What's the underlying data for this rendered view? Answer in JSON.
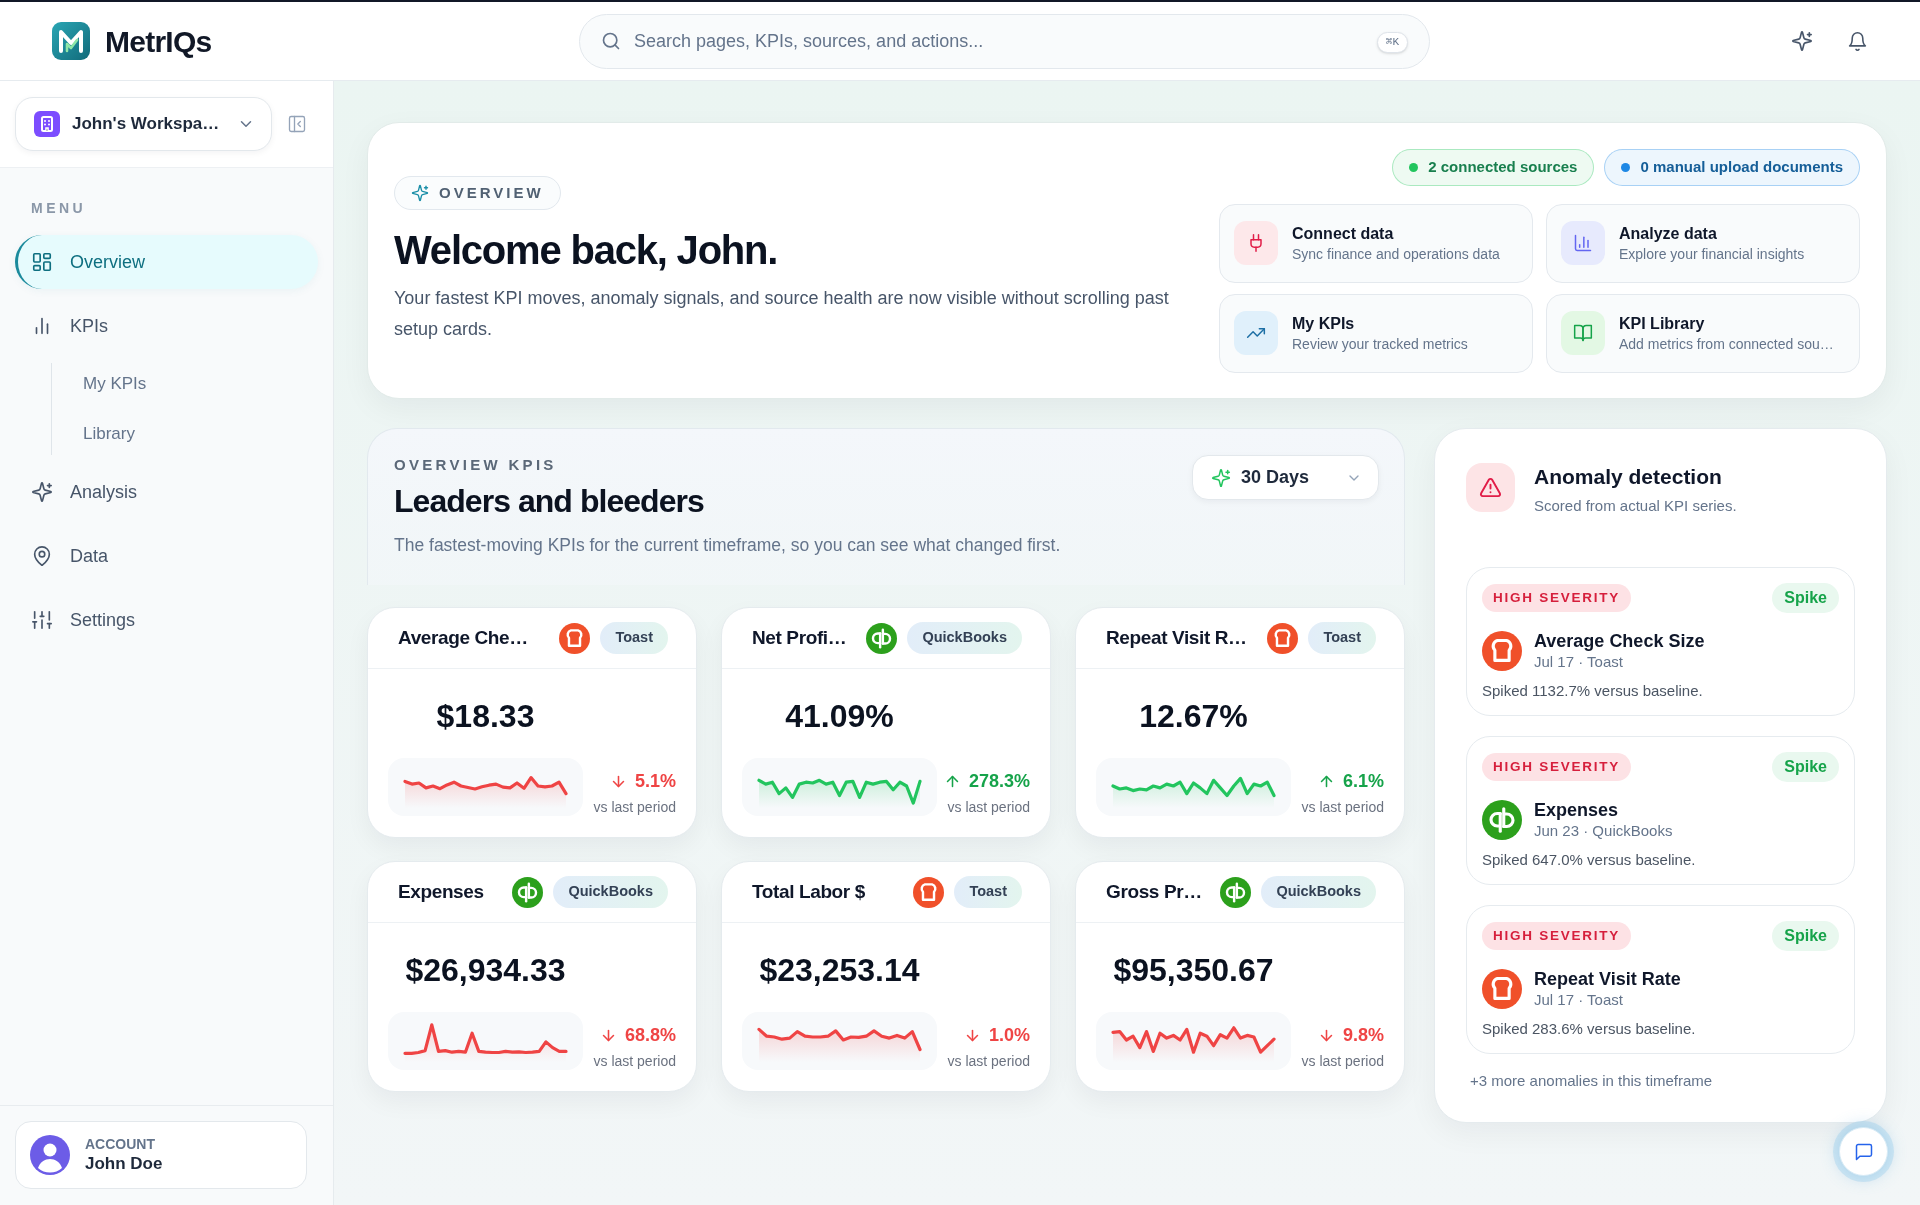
{
  "app": {
    "name": "MetrIQs"
  },
  "search": {
    "placeholder": "Search pages, KPIs, sources, and actions...",
    "shortcut": "⌘K"
  },
  "workspace": {
    "name": "John's Workspa…"
  },
  "sidebar": {
    "section_label": "MENU",
    "items": [
      {
        "label": "Overview",
        "selected": true
      },
      {
        "label": "KPIs",
        "selected": false,
        "children": [
          {
            "label": "My KPIs",
            "selected": false
          },
          {
            "label": "Library",
            "selected": false
          }
        ]
      },
      {
        "label": "Analysis",
        "selected": false
      },
      {
        "label": "Data",
        "selected": false
      },
      {
        "label": "Settings",
        "selected": false
      }
    ]
  },
  "account": {
    "label": "ACCOUNT",
    "name": "John Doe"
  },
  "overview": {
    "eyebrow": "OVERVIEW",
    "title": "Welcome back, John.",
    "description": "Your fastest KPI moves, anomaly signals, and source health are now visible without scrolling past setup cards.",
    "badges": [
      {
        "label": "2 connected sources",
        "color": "#22c55e"
      },
      {
        "label": "0 manual upload documents",
        "color": "#1e88e5"
      }
    ],
    "actions": [
      {
        "title": "Connect data",
        "subtitle": "Sync finance and operations data"
      },
      {
        "title": "Analyze data",
        "subtitle": "Explore your financial insights"
      },
      {
        "title": "My KPIs",
        "subtitle": "Review your tracked metrics"
      },
      {
        "title": "KPI Library",
        "subtitle": "Add metrics from connected sou…"
      }
    ]
  },
  "kpis": {
    "eyebrow": "OVERVIEW KPIS",
    "title": "Leaders and bleeders",
    "description": "The fastest-moving KPIs for the current timeframe, so you can see what changed first.",
    "timeframe": "30 Days",
    "cards": [
      {
        "title": "Average Che…",
        "source": "Toast",
        "value": "$18.33",
        "increase": false,
        "change": "5.1%",
        "caption": "vs last period"
      },
      {
        "title": "Net Profi…",
        "source": "QuickBooks",
        "value": "41.09%",
        "increase": true,
        "change": "278.3%",
        "caption": "vs last period"
      },
      {
        "title": "Repeat Visit R…",
        "source": "Toast",
        "value": "12.67%",
        "increase": true,
        "change": "6.1%",
        "caption": "vs last period"
      },
      {
        "title": "Expenses",
        "source": "QuickBooks",
        "value": "$26,934.33",
        "increase": false,
        "change": "68.8%",
        "caption": "vs last period"
      },
      {
        "title": "Total Labor $",
        "source": "Toast",
        "value": "$23,253.14",
        "increase": false,
        "change": "1.0%",
        "caption": "vs last period"
      },
      {
        "title": "Gross Pr…",
        "source": "QuickBooks",
        "value": "$95,350.67",
        "increase": false,
        "change": "9.8%",
        "caption": "vs last period"
      }
    ]
  },
  "anomalies": {
    "title": "Anomaly detection",
    "subtitle": "Scored from actual KPI series.",
    "items": [
      {
        "severity": "HIGH SEVERITY",
        "type": "Spike",
        "title": "Average Check Size",
        "meta": "Jul 17 · Toast",
        "description": "Spiked 1132.7% versus baseline."
      },
      {
        "severity": "HIGH SEVERITY",
        "type": "Spike",
        "title": "Expenses",
        "meta": "Jun 23 · QuickBooks",
        "description": "Spiked 647.0% versus baseline."
      },
      {
        "severity": "HIGH SEVERITY",
        "type": "Spike",
        "title": "Repeat Visit Rate",
        "meta": "Jul 17 · Toast",
        "description": "Spiked 283.6% versus baseline."
      }
    ],
    "footer": "+3 more anomalies in this timeframe"
  }
}
